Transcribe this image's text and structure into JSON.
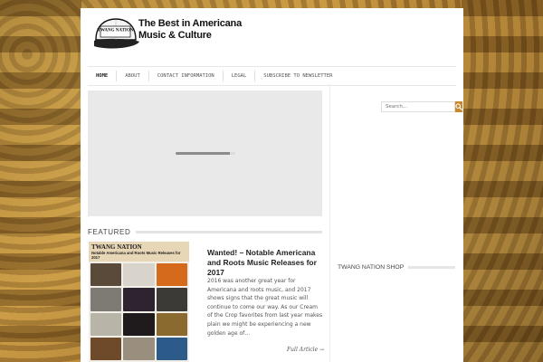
{
  "site": {
    "title_line1": "The Best in Americana",
    "title_line2": "Music & Culture",
    "logo_text": "TWANG NATION"
  },
  "nav": {
    "items": [
      {
        "label": "HOME",
        "active": true
      },
      {
        "label": "ABOUT",
        "active": false
      },
      {
        "label": "CONTACT INFORMATION",
        "active": false
      },
      {
        "label": "LEGAL",
        "active": false
      },
      {
        "label": "SUBSCRIBE TO NEWSLETTER",
        "active": false
      }
    ]
  },
  "featured": {
    "heading": "FEATURED",
    "thumbnail": {
      "brand": "TWANG NATION",
      "caption": "Notable Americana and Roots Music Releases for 2017"
    },
    "post": {
      "title": "Wanted! – Notable Americana and Roots Music Releases for 2017",
      "excerpt": "2016 was another great year for Americana and roots music, and 2017 shows signs that the great music will continue to come our way. As our Cream of the Crop favorites from last year makes plain we might be experiencing a new golden age of…",
      "read_more": "Full Article →"
    }
  },
  "sidebar": {
    "search_placeholder": "Search...",
    "shop_heading": "TWANG NATION SHOP"
  },
  "colors": {
    "accent": "#c9862a",
    "page_bg": "#ffffff",
    "video_bg": "#e9e9e9"
  }
}
